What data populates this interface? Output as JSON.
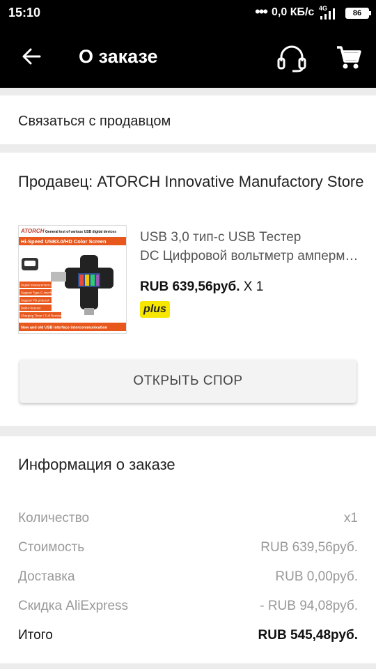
{
  "status_bar": {
    "time": "15:10",
    "network_speed": "0,0 КБ/с",
    "signal_label": "4G",
    "battery": "86"
  },
  "app_bar": {
    "title": "О заказе",
    "icons": [
      "back-arrow-icon",
      "headset-support-icon",
      "cart-icon"
    ]
  },
  "contact": {
    "label": "Связаться с продавцом"
  },
  "seller": {
    "label": "Продавец: ATORCH Innovative Manufactory Store"
  },
  "product": {
    "name_line1": "USB 3,0 тип-с USB Тестер",
    "name_line2": "DC Цифровой вольтметр амперметр",
    "price": "RUB 639,56руб.",
    "quantity": "X 1",
    "badge": "plus",
    "image": {
      "brand": "ATORCH",
      "headline": "General test of various USB digital devices",
      "banner": "Hi-Speed USB3.0/HD Color Screen",
      "features": [
        "Digital measurement display",
        "Support Type-C interface",
        "Support PD protocol",
        "Built-in buzzer",
        "Charging Timer / Full Reminder"
      ],
      "footer": "New and old USB interface intercommunication"
    }
  },
  "dispute_button": {
    "label": "ОТКРЫТЬ СПОР"
  },
  "order_info": {
    "heading": "Информация о заказе",
    "rows": [
      {
        "key": "Количество",
        "value": "x1"
      },
      {
        "key": "Стоимость",
        "value": "RUB 639,56руб."
      },
      {
        "key": "Доставка",
        "value": "RUB 0,00руб."
      },
      {
        "key": "Скидка AliExpress",
        "value": "- RUB 94,08руб."
      },
      {
        "key": "Итого",
        "value": "RUB 545,48руб."
      }
    ]
  },
  "colors": {
    "app_bar": "#000000",
    "background": "#ececec",
    "badge": "#f7e600"
  }
}
